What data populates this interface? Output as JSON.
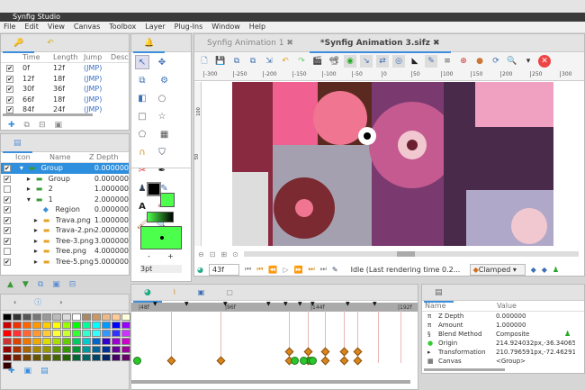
{
  "window": {
    "title": "Synfig Studio"
  },
  "menu": [
    "File",
    "Edit",
    "View",
    "Canvas",
    "Toolbox",
    "Layer",
    "Plug-Ins",
    "Window",
    "Help"
  ],
  "keyframes": {
    "columns": [
      "Time",
      "Length",
      "Jump",
      "Desc"
    ],
    "rows": [
      {
        "time": "0f",
        "length": "12f",
        "jump": "(JMP)",
        "checked": true
      },
      {
        "time": "12f",
        "length": "18f",
        "jump": "(JMP)",
        "checked": true
      },
      {
        "time": "30f",
        "length": "36f",
        "jump": "(JMP)",
        "checked": true
      },
      {
        "time": "66f",
        "length": "18f",
        "jump": "(JMP)",
        "checked": true
      },
      {
        "time": "84f",
        "length": "24f",
        "jump": "(JMP)",
        "checked": true
      }
    ]
  },
  "layers": {
    "columns": [
      "Icon",
      "Name",
      "Z Depth"
    ],
    "rows": [
      {
        "name": "Group",
        "z": "0.000000",
        "checked": true,
        "icon": "folder-green",
        "indent": 0,
        "expander": "▾",
        "selected": true
      },
      {
        "name": "Group",
        "z": "0.000000",
        "checked": true,
        "icon": "folder-green",
        "indent": 1,
        "expander": "▸"
      },
      {
        "name": "2",
        "z": "1.000000",
        "checked": false,
        "icon": "folder-green",
        "indent": 1,
        "expander": "▸"
      },
      {
        "name": "1",
        "z": "2.000000",
        "checked": true,
        "icon": "folder-green",
        "indent": 1,
        "expander": "▾"
      },
      {
        "name": "Region",
        "z": "0.000000",
        "checked": true,
        "icon": "region",
        "indent": 2,
        "expander": ""
      },
      {
        "name": "Trava.png",
        "z": "1.000000",
        "checked": true,
        "icon": "folder-orange",
        "indent": 2,
        "expander": "▸"
      },
      {
        "name": "Trava-2.png",
        "z": "2.000000",
        "checked": true,
        "icon": "folder-orange",
        "indent": 2,
        "expander": "▸"
      },
      {
        "name": "Tree-3.png",
        "z": "3.000000",
        "checked": true,
        "icon": "folder-orange",
        "indent": 2,
        "expander": "▸"
      },
      {
        "name": "Tree.png",
        "z": "4.000000",
        "checked": false,
        "icon": "folder-orange",
        "indent": 2,
        "expander": "▸"
      },
      {
        "name": "Tree-5.png",
        "z": "5.000000",
        "checked": true,
        "icon": "folder-orange",
        "indent": 2,
        "expander": "▸"
      }
    ]
  },
  "toolbox": {
    "brush_size": "3pt",
    "minus": "-",
    "plus": "+",
    "outline_color": "#000000",
    "fill_color": "#4cff4c"
  },
  "canvas": {
    "tabs": [
      "Synfig Animation 1",
      "*Synfig Animation 3.sifz"
    ],
    "active_tab": 1,
    "ruler": [
      "-300",
      "-250",
      "-200",
      "-150",
      "-100",
      "-50",
      "0",
      "50",
      "100",
      "150",
      "200",
      "250",
      "300"
    ],
    "vruler": [
      "100",
      "50"
    ],
    "frame": "43f",
    "status": "Idle (Last rendering time 0.2...",
    "interpolation": "Clamped"
  },
  "timeline": {
    "labels": [
      "|48f",
      "|96f",
      "|144f",
      "|192f"
    ]
  },
  "params": {
    "columns": [
      "Name",
      "Value"
    ],
    "rows": [
      {
        "icon": "π",
        "name": "Z Depth",
        "value": "0.000000"
      },
      {
        "icon": "π",
        "name": "Amount",
        "value": "1.000000"
      },
      {
        "icon": "§",
        "name": "Blend Method",
        "value": "Composite"
      },
      {
        "icon": "●",
        "name": "Origin",
        "value": "214.924032px,-36.340650"
      },
      {
        "icon": "▸",
        "name": "Transformation",
        "value": "210.796591px,-72.462913"
      },
      {
        "icon": "▦",
        "name": "Canvas",
        "value": "<Group>"
      }
    ]
  }
}
